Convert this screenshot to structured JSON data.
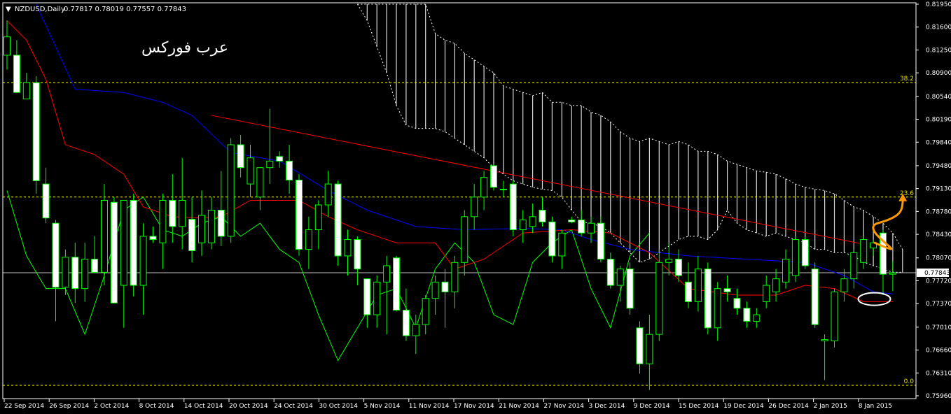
{
  "header": {
    "arrow": "▼",
    "symbol": "NZDUSD,Daily",
    "ohlc": "0.77817 0.78019 0.77557 0.77843"
  },
  "watermark": "عرب فوركس",
  "colors": {
    "background": "#000000",
    "bull_body": "#000000",
    "bear_body": "#ffffff",
    "wick": "#00ff00",
    "tenkan": "#ff0000",
    "kijun": "#0000ff",
    "chikou": "#00ff00",
    "cloud": "#ffffff",
    "fib": "#ffff00",
    "trendline": "#ff0000",
    "annotation": "#ff9900",
    "price_line": "#c0c0c0"
  },
  "chart_data": {
    "type": "candlestick",
    "y_range": [
      0.7596,
      0.8195
    ],
    "y_ticks": [
      "0.81950",
      "0.81600",
      "0.81250",
      "0.80900",
      "0.80540",
      "0.80190",
      "0.79840",
      "0.79480",
      "0.79130",
      "0.78780",
      "0.78430",
      "0.78070",
      "0.77720",
      "0.77370",
      "0.77010",
      "0.76660",
      "0.76310",
      "0.75960"
    ],
    "x_labels": [
      "22 Sep 2014",
      "26 Sep 2014",
      "2 Oct 2014",
      "8 Oct 2014",
      "14 Oct 2014",
      "20 Oct 2014",
      "24 Oct 2014",
      "30 Oct 2014",
      "5 Nov 2014",
      "11 Nov 2014",
      "17 Nov 2014",
      "21 Nov 2014",
      "27 Nov 2014",
      "3 Dec 2014",
      "9 Dec 2014",
      "15 Dec 2014",
      "19 Dec 2014",
      "26 Dec 2014",
      "2 Jan 2015",
      "8 Jan 2015"
    ],
    "current_price": "0.77843",
    "current_price_value": 0.77843,
    "fib_levels": [
      {
        "label": "38.2",
        "value": 0.8075
      },
      {
        "label": "23.6",
        "value": 0.79
      },
      {
        "label": "0.0",
        "value": 0.7612
      }
    ],
    "candles": [
      {
        "o": 0.8117,
        "h": 0.817,
        "l": 0.8095,
        "c": 0.8145
      },
      {
        "o": 0.8117,
        "h": 0.814,
        "l": 0.806,
        "c": 0.806
      },
      {
        "o": 0.805,
        "h": 0.809,
        "l": 0.805,
        "c": 0.8075
      },
      {
        "o": 0.8075,
        "h": 0.8085,
        "l": 0.7905,
        "c": 0.7925
      },
      {
        "o": 0.792,
        "h": 0.7945,
        "l": 0.786,
        "c": 0.7868
      },
      {
        "o": 0.786,
        "h": 0.7865,
        "l": 0.771,
        "c": 0.7762
      },
      {
        "o": 0.7762,
        "h": 0.782,
        "l": 0.775,
        "c": 0.7808
      },
      {
        "o": 0.7808,
        "h": 0.783,
        "l": 0.7738,
        "c": 0.776
      },
      {
        "o": 0.776,
        "h": 0.783,
        "l": 0.774,
        "c": 0.7805
      },
      {
        "o": 0.7805,
        "h": 0.784,
        "l": 0.7785,
        "c": 0.7785
      },
      {
        "o": 0.7785,
        "h": 0.792,
        "l": 0.7765,
        "c": 0.7895
      },
      {
        "o": 0.7892,
        "h": 0.79,
        "l": 0.7738,
        "c": 0.7738
      },
      {
        "o": 0.7765,
        "h": 0.7893,
        "l": 0.77,
        "c": 0.7895
      },
      {
        "o": 0.7895,
        "h": 0.7905,
        "l": 0.7748,
        "c": 0.7765
      },
      {
        "o": 0.7765,
        "h": 0.786,
        "l": 0.772,
        "c": 0.784
      },
      {
        "o": 0.784,
        "h": 0.7855,
        "l": 0.783,
        "c": 0.7835
      },
      {
        "o": 0.783,
        "h": 0.7905,
        "l": 0.779,
        "c": 0.7895
      },
      {
        "o": 0.7895,
        "h": 0.7935,
        "l": 0.783,
        "c": 0.7855
      },
      {
        "o": 0.7855,
        "h": 0.796,
        "l": 0.782,
        "c": 0.7895
      },
      {
        "o": 0.7866,
        "h": 0.79,
        "l": 0.78,
        "c": 0.7818
      },
      {
        "o": 0.783,
        "h": 0.791,
        "l": 0.781,
        "c": 0.7872
      },
      {
        "o": 0.783,
        "h": 0.79,
        "l": 0.782,
        "c": 0.788
      },
      {
        "o": 0.788,
        "h": 0.794,
        "l": 0.7825,
        "c": 0.784
      },
      {
        "o": 0.784,
        "h": 0.799,
        "l": 0.783,
        "c": 0.798
      },
      {
        "o": 0.798,
        "h": 0.7995,
        "l": 0.793,
        "c": 0.7945
      },
      {
        "o": 0.792,
        "h": 0.798,
        "l": 0.79,
        "c": 0.796
      },
      {
        "o": 0.79,
        "h": 0.7945,
        "l": 0.788,
        "c": 0.7945
      },
      {
        "o": 0.7945,
        "h": 0.8035,
        "l": 0.792,
        "c": 0.7955
      },
      {
        "o": 0.7962,
        "h": 0.797,
        "l": 0.7945,
        "c": 0.7955
      },
      {
        "o": 0.7955,
        "h": 0.798,
        "l": 0.7905,
        "c": 0.7926
      },
      {
        "o": 0.7926,
        "h": 0.7935,
        "l": 0.781,
        "c": 0.782
      },
      {
        "o": 0.782,
        "h": 0.787,
        "l": 0.779,
        "c": 0.785
      },
      {
        "o": 0.785,
        "h": 0.7895,
        "l": 0.782,
        "c": 0.7888
      },
      {
        "o": 0.7888,
        "h": 0.794,
        "l": 0.787,
        "c": 0.792
      },
      {
        "o": 0.792,
        "h": 0.7925,
        "l": 0.7795,
        "c": 0.781
      },
      {
        "o": 0.781,
        "h": 0.785,
        "l": 0.778,
        "c": 0.7835
      },
      {
        "o": 0.7835,
        "h": 0.784,
        "l": 0.7765,
        "c": 0.779
      },
      {
        "o": 0.7775,
        "h": 0.7775,
        "l": 0.77,
        "c": 0.772
      },
      {
        "o": 0.772,
        "h": 0.778,
        "l": 0.77,
        "c": 0.777
      },
      {
        "o": 0.777,
        "h": 0.781,
        "l": 0.769,
        "c": 0.7795
      },
      {
        "o": 0.7807,
        "h": 0.781,
        "l": 0.7725,
        "c": 0.7727
      },
      {
        "o": 0.7727,
        "h": 0.776,
        "l": 0.768,
        "c": 0.7688
      },
      {
        "o": 0.7688,
        "h": 0.772,
        "l": 0.766,
        "c": 0.7705
      },
      {
        "o": 0.7705,
        "h": 0.775,
        "l": 0.769,
        "c": 0.7745
      },
      {
        "o": 0.7745,
        "h": 0.778,
        "l": 0.772,
        "c": 0.777
      },
      {
        "o": 0.777,
        "h": 0.779,
        "l": 0.77,
        "c": 0.7755
      },
      {
        "o": 0.7755,
        "h": 0.781,
        "l": 0.773,
        "c": 0.78
      },
      {
        "o": 0.78,
        "h": 0.788,
        "l": 0.778,
        "c": 0.787
      },
      {
        "o": 0.787,
        "h": 0.792,
        "l": 0.785,
        "c": 0.79
      },
      {
        "o": 0.79,
        "h": 0.794,
        "l": 0.788,
        "c": 0.793
      },
      {
        "o": 0.7948,
        "h": 0.795,
        "l": 0.791,
        "c": 0.7915
      },
      {
        "o": 0.7912,
        "h": 0.7925,
        "l": 0.79,
        "c": 0.7912
      },
      {
        "o": 0.792,
        "h": 0.7925,
        "l": 0.784,
        "c": 0.785
      },
      {
        "o": 0.785,
        "h": 0.788,
        "l": 0.783,
        "c": 0.7865
      },
      {
        "o": 0.7855,
        "h": 0.789,
        "l": 0.7845,
        "c": 0.787
      },
      {
        "o": 0.788,
        "h": 0.79,
        "l": 0.7855,
        "c": 0.7862
      },
      {
        "o": 0.7862,
        "h": 0.787,
        "l": 0.78,
        "c": 0.781
      },
      {
        "o": 0.781,
        "h": 0.785,
        "l": 0.779,
        "c": 0.7845
      },
      {
        "o": 0.7865,
        "h": 0.787,
        "l": 0.786,
        "c": 0.7862
      },
      {
        "o": 0.7865,
        "h": 0.788,
        "l": 0.784,
        "c": 0.7845
      },
      {
        "o": 0.7845,
        "h": 0.787,
        "l": 0.783,
        "c": 0.786
      },
      {
        "o": 0.786,
        "h": 0.787,
        "l": 0.78,
        "c": 0.7805
      },
      {
        "o": 0.7805,
        "h": 0.7815,
        "l": 0.776,
        "c": 0.7765
      },
      {
        "o": 0.7765,
        "h": 0.7795,
        "l": 0.774,
        "c": 0.779
      },
      {
        "o": 0.779,
        "h": 0.78,
        "l": 0.772,
        "c": 0.773
      },
      {
        "o": 0.77,
        "h": 0.771,
        "l": 0.763,
        "c": 0.7645
      },
      {
        "o": 0.7645,
        "h": 0.772,
        "l": 0.7605,
        "c": 0.769
      },
      {
        "o": 0.769,
        "h": 0.782,
        "l": 0.768,
        "c": 0.78
      },
      {
        "o": 0.78,
        "h": 0.783,
        "l": 0.778,
        "c": 0.7805
      },
      {
        "o": 0.7805,
        "h": 0.782,
        "l": 0.777,
        "c": 0.778
      },
      {
        "o": 0.777,
        "h": 0.78,
        "l": 0.773,
        "c": 0.774
      },
      {
        "o": 0.774,
        "h": 0.781,
        "l": 0.7725,
        "c": 0.779
      },
      {
        "o": 0.779,
        "h": 0.78,
        "l": 0.769,
        "c": 0.77
      },
      {
        "o": 0.77,
        "h": 0.777,
        "l": 0.768,
        "c": 0.776
      },
      {
        "o": 0.776,
        "h": 0.778,
        "l": 0.774,
        "c": 0.7755
      },
      {
        "o": 0.7745,
        "h": 0.776,
        "l": 0.772,
        "c": 0.773
      },
      {
        "o": 0.773,
        "h": 0.774,
        "l": 0.77,
        "c": 0.771
      },
      {
        "o": 0.771,
        "h": 0.773,
        "l": 0.77,
        "c": 0.772
      },
      {
        "o": 0.774,
        "h": 0.778,
        "l": 0.773,
        "c": 0.7765
      },
      {
        "o": 0.7755,
        "h": 0.779,
        "l": 0.774,
        "c": 0.7775
      },
      {
        "o": 0.777,
        "h": 0.782,
        "l": 0.776,
        "c": 0.7805
      },
      {
        "o": 0.778,
        "h": 0.784,
        "l": 0.777,
        "c": 0.7835
      },
      {
        "o": 0.7835,
        "h": 0.784,
        "l": 0.779,
        "c": 0.7795
      },
      {
        "o": 0.779,
        "h": 0.78,
        "l": 0.77,
        "c": 0.7705
      },
      {
        "o": 0.768,
        "h": 0.769,
        "l": 0.762,
        "c": 0.7682
      },
      {
        "o": 0.768,
        "h": 0.776,
        "l": 0.767,
        "c": 0.7755
      },
      {
        "o": 0.7755,
        "h": 0.779,
        "l": 0.774,
        "c": 0.7775
      },
      {
        "o": 0.7775,
        "h": 0.782,
        "l": 0.776,
        "c": 0.7815
      },
      {
        "o": 0.78,
        "h": 0.784,
        "l": 0.779,
        "c": 0.7835
      },
      {
        "o": 0.7822,
        "h": 0.7835,
        "l": 0.781,
        "c": 0.783
      },
      {
        "o": 0.7845,
        "h": 0.785,
        "l": 0.775,
        "c": 0.7782
      },
      {
        "o": 0.7782,
        "h": 0.7802,
        "l": 0.7756,
        "c": 0.7784
      }
    ],
    "tenkan": [
      [
        0,
        0.817
      ],
      [
        2,
        0.814
      ],
      [
        4,
        0.808
      ],
      [
        6,
        0.798
      ],
      [
        9,
        0.7965
      ],
      [
        12,
        0.7935
      ],
      [
        14,
        0.7885
      ],
      [
        17,
        0.787
      ],
      [
        20,
        0.7868
      ],
      [
        22,
        0.787
      ],
      [
        25,
        0.7895
      ],
      [
        30,
        0.7895
      ],
      [
        33,
        0.787
      ],
      [
        36,
        0.785
      ],
      [
        40,
        0.783
      ],
      [
        44,
        0.783
      ],
      [
        46,
        0.779
      ],
      [
        49,
        0.7805
      ],
      [
        53,
        0.7845
      ],
      [
        58,
        0.785
      ],
      [
        62,
        0.7845
      ],
      [
        66,
        0.7815
      ],
      [
        70,
        0.776
      ],
      [
        75,
        0.775
      ],
      [
        79,
        0.775
      ],
      [
        82,
        0.7765
      ],
      [
        85,
        0.776
      ],
      [
        88,
        0.774
      ],
      [
        91,
        0.774
      ]
    ],
    "kijun": [
      [
        3,
        0.8195
      ],
      [
        7,
        0.8065
      ],
      [
        12,
        0.806
      ],
      [
        16,
        0.8045
      ],
      [
        19,
        0.8025
      ],
      [
        23,
        0.7968
      ],
      [
        28,
        0.7955
      ],
      [
        33,
        0.791
      ],
      [
        37,
        0.788
      ],
      [
        42,
        0.7855
      ],
      [
        47,
        0.785
      ],
      [
        53,
        0.7852
      ],
      [
        57,
        0.785
      ],
      [
        60,
        0.7835
      ],
      [
        64,
        0.782
      ],
      [
        70,
        0.781
      ],
      [
        76,
        0.7805
      ],
      [
        82,
        0.78
      ],
      [
        86,
        0.778
      ],
      [
        89,
        0.7755
      ],
      [
        91,
        0.7752
      ]
    ],
    "chikou": [
      [
        0,
        0.791
      ],
      [
        2,
        0.781
      ],
      [
        4,
        0.776
      ],
      [
        6,
        0.776
      ],
      [
        8,
        0.769
      ],
      [
        10,
        0.778
      ],
      [
        12,
        0.788
      ],
      [
        14,
        0.79
      ],
      [
        16,
        0.785
      ],
      [
        18,
        0.784
      ],
      [
        20,
        0.786
      ],
      [
        22,
        0.787
      ],
      [
        24,
        0.784
      ],
      [
        26,
        0.786
      ],
      [
        28,
        0.782
      ],
      [
        30,
        0.78
      ],
      [
        32,
        0.772
      ],
      [
        34,
        0.765
      ],
      [
        36,
        0.77
      ],
      [
        38,
        0.775
      ],
      [
        40,
        0.776
      ],
      [
        42,
        0.77
      ],
      [
        44,
        0.779
      ],
      [
        46,
        0.783
      ],
      [
        48,
        0.78
      ],
      [
        50,
        0.772
      ],
      [
        52,
        0.7705
      ],
      [
        54,
        0.78
      ],
      [
        56,
        0.783
      ],
      [
        58,
        0.785
      ],
      [
        60,
        0.776
      ],
      [
        62,
        0.77
      ],
      [
        64,
        0.781
      ],
      [
        66,
        0.7845
      ]
    ],
    "cloud": {
      "i0": 36,
      "a": [
        0.8195,
        0.817,
        0.813,
        0.809,
        0.804,
        0.801,
        0.8005,
        0.8005,
        0.8005,
        0.8,
        0.799,
        0.798,
        0.797,
        0.796,
        0.7945,
        0.7935,
        0.7925,
        0.792,
        0.7915,
        0.7912,
        0.791,
        0.79,
        0.788,
        0.7862,
        0.786,
        0.7855,
        0.7845,
        0.783,
        0.7815,
        0.78,
        0.7805,
        0.7815,
        0.7825,
        0.7835,
        0.784,
        0.784,
        0.7835,
        0.785,
        0.788,
        0.786,
        0.785,
        0.7845,
        0.784,
        0.7845,
        0.784,
        0.7835,
        0.783,
        0.782,
        0.782,
        0.7815,
        0.7815,
        0.781,
        0.78,
        0.7795,
        0.779,
        0.7785,
        0.7785
      ],
      "b": [
        0.8195,
        0.8195,
        0.8195,
        0.8195,
        0.8195,
        0.8195,
        0.8195,
        0.8195,
        0.815,
        0.814,
        0.8135,
        0.812,
        0.811,
        0.81,
        0.809,
        0.807,
        0.8065,
        0.806,
        0.8055,
        0.806,
        0.8045,
        0.8045,
        0.804,
        0.804,
        0.803,
        0.8025,
        0.8015,
        0.8,
        0.799,
        0.7985,
        0.799,
        0.7985,
        0.798,
        0.7985,
        0.798,
        0.797,
        0.797,
        0.7965,
        0.7955,
        0.795,
        0.7945,
        0.794,
        0.7938,
        0.7935,
        0.7928,
        0.792,
        0.7915,
        0.7912,
        0.791,
        0.7905,
        0.7895,
        0.7885,
        0.788,
        0.787,
        0.786,
        0.7845,
        0.782
      ]
    },
    "trendline": [
      [
        21,
        0.8025
      ],
      [
        88,
        0.7828
      ]
    ]
  }
}
